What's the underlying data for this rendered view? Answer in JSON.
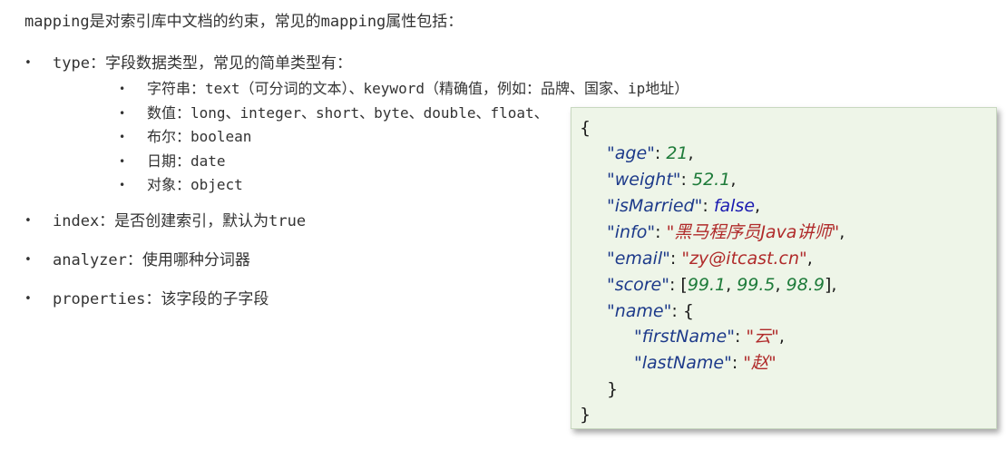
{
  "intro": "mapping是对索引库中文档的约束，常见的mapping属性包括：",
  "bullets": {
    "type": "type：字段数据类型，常见的简单类型有：",
    "index": "index：是否创建索引，默认为true",
    "analyzer": "analyzer：使用哪种分词器",
    "properties": "properties：该字段的子字段"
  },
  "sub_bullets": [
    "字符串：text（可分词的文本）、keyword（精确值，例如：品牌、国家、ip地址）",
    "数值：long、integer、short、byte、double、float、",
    "布尔：boolean",
    "日期：date",
    "对象：object"
  ],
  "bullet_glyph": "•",
  "json_example": {
    "open_brace": "{",
    "close_brace": "}",
    "age_key": "\"age\"",
    "age_value": "21",
    "weight_key": "\"weight\"",
    "weight_value": "52.1",
    "isMarried_key": "\"isMarried\"",
    "isMarried_value": "false",
    "info_key": "\"info\"",
    "info_value": "\"黑马程序员Java讲师\"",
    "email_key": "\"email\"",
    "email_value": "\"zy@itcast.cn\"",
    "score_key": "\"score\"",
    "score_values": [
      "99.1",
      "99.5",
      "98.9"
    ],
    "name_key": "\"name\"",
    "firstName_key": "\"firstName\"",
    "firstName_value": "\"云\"",
    "lastName_key": "\"lastName\"",
    "lastName_value": "\"赵\""
  },
  "colors": {
    "key": "#1d3a8a",
    "number": "#1e7b3a",
    "boolean": "#1a1ab0",
    "string": "#b02a2a",
    "box_background": "#eef5e8"
  }
}
